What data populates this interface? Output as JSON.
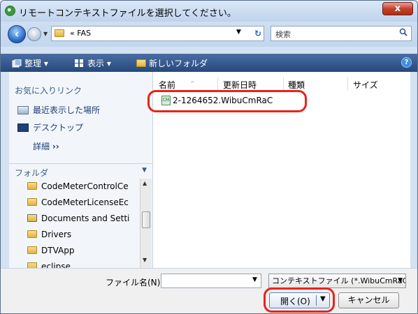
{
  "window": {
    "title": "リモートコンテキストファイルを選択してください。",
    "close_label": "x"
  },
  "address": {
    "path_chevron": "«",
    "path": "FAS",
    "search_placeholder": "検索"
  },
  "toolbar": {
    "organize": "整理",
    "views": "表示",
    "new_folder": "新しいフォルダ",
    "help": "?"
  },
  "sidebar": {
    "favorites_title": "お気に入りリンク",
    "favorites": [
      {
        "label": "最近表示した場所",
        "icon": "recent-places-icon"
      },
      {
        "label": "デスクトップ",
        "icon": "desktop-icon"
      }
    ],
    "more_label": "詳細",
    "more_chevron": "››",
    "folders_title": "フォルダ",
    "folders": [
      {
        "label": "CodeMeterControlCe",
        "icon": "folder-icon"
      },
      {
        "label": "CodeMeterLicenseEc",
        "icon": "folder-icon"
      },
      {
        "label": "Documents and Setti",
        "icon": "shortcut-folder-icon"
      },
      {
        "label": "Drivers",
        "icon": "folder-icon"
      },
      {
        "label": "DTVApp",
        "icon": "folder-icon"
      },
      {
        "label": "eclipse",
        "icon": "folder-icon"
      }
    ]
  },
  "file_list": {
    "columns": [
      "名前",
      "更新日時",
      "種類",
      "サイズ"
    ],
    "files": [
      {
        "name": "2-1264652.WibuCmRaC",
        "icon": "wibu-file-icon"
      }
    ]
  },
  "bottom": {
    "filename_label": "ファイル名(N):",
    "filename_value": "",
    "filter_value": "コンテキストファイル (*.WibuCmRaC",
    "open_label": "開く(O)",
    "cancel_label": "キャンセル"
  },
  "colors": {
    "highlight": "#e8231a",
    "toolbar": "#27487c"
  }
}
